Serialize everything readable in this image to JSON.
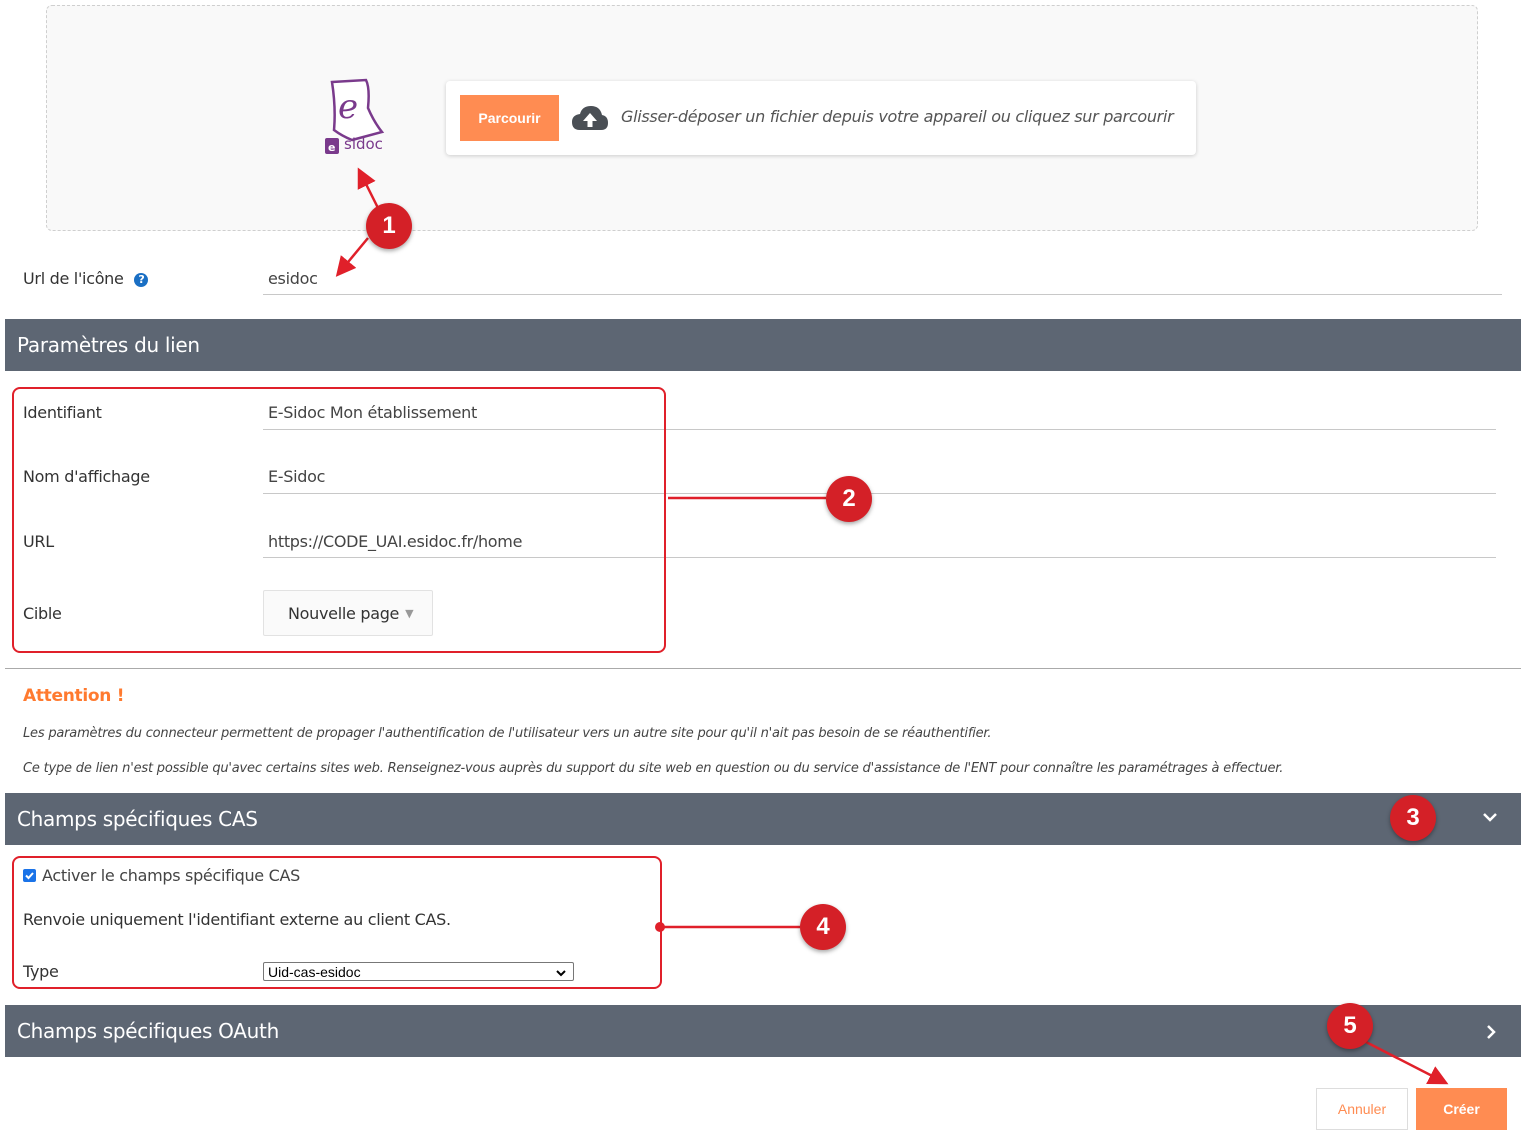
{
  "upload": {
    "browse_label": "Parcourir",
    "drop_hint": "Glisser-déposer un fichier depuis votre appareil ou cliquez sur parcourir",
    "logo_text": "sidoc"
  },
  "icon_url": {
    "label": "Url de l'icône",
    "value": "esidoc"
  },
  "link_params": {
    "title": "Paramètres du lien",
    "identifier_label": "Identifiant",
    "identifier_value": "E-Sidoc Mon établissement",
    "display_name_label": "Nom d'affichage",
    "display_name_value": "E-Sidoc",
    "url_label": "URL",
    "url_value": "https://CODE_UAI.esidoc.fr/home",
    "target_label": "Cible",
    "target_value": "Nouvelle page"
  },
  "warning": {
    "title": "Attention !",
    "line1": "Les paramètres du connecteur permettent de propager l'authentification de l'utilisateur vers un autre site pour qu'il n'ait pas besoin de se réauthentifier.",
    "line2": "Ce type de lien n'est possible qu'avec certains sites web. Renseignez-vous auprès du support du site web en question ou du service d'assistance de l'ENT pour connaître les paramétrages à effectuer."
  },
  "cas": {
    "title": "Champs spécifiques CAS",
    "checkbox_label": "Activer le champs spécifique CAS",
    "checked": true,
    "description": "Renvoie uniquement l'identifiant externe au client CAS.",
    "type_label": "Type",
    "type_value": "Uid-cas-esidoc"
  },
  "oauth": {
    "title": "Champs spécifiques OAuth"
  },
  "actions": {
    "cancel_label": "Annuler",
    "create_label": "Créer"
  },
  "markers": [
    "1",
    "2",
    "3",
    "4",
    "5"
  ],
  "colors": {
    "accent": "#ff8c52",
    "section_bar": "#5d6673",
    "annotation_red": "#d42027"
  }
}
